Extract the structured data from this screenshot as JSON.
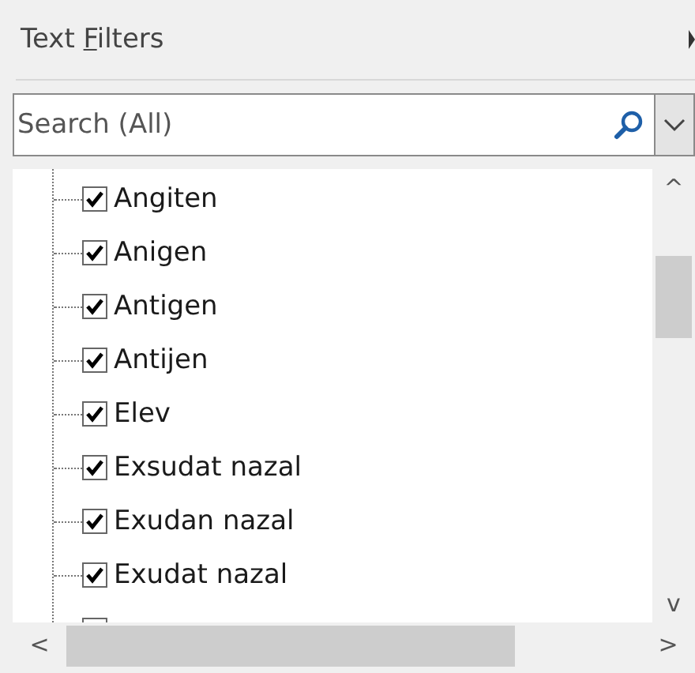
{
  "menu_item": {
    "label_before_key": "Text ",
    "key": "F",
    "label_after_key": "ilters"
  },
  "search": {
    "placeholder": "Search (All)"
  },
  "items": [
    {
      "label": "Angiten",
      "checked": true
    },
    {
      "label": "Anigen",
      "checked": true
    },
    {
      "label": "Antigen",
      "checked": true
    },
    {
      "label": "Antijen",
      "checked": true
    },
    {
      "label": "Elev",
      "checked": true
    },
    {
      "label": "Exsudat nazal",
      "checked": true
    },
    {
      "label": "Exudan nazal",
      "checked": true
    },
    {
      "label": "Exudat nazal",
      "checked": true
    }
  ],
  "vertical_scrollbar": {
    "up": "^",
    "down": "v"
  },
  "horizontal_scrollbar": {
    "left": "<",
    "right": ">"
  }
}
